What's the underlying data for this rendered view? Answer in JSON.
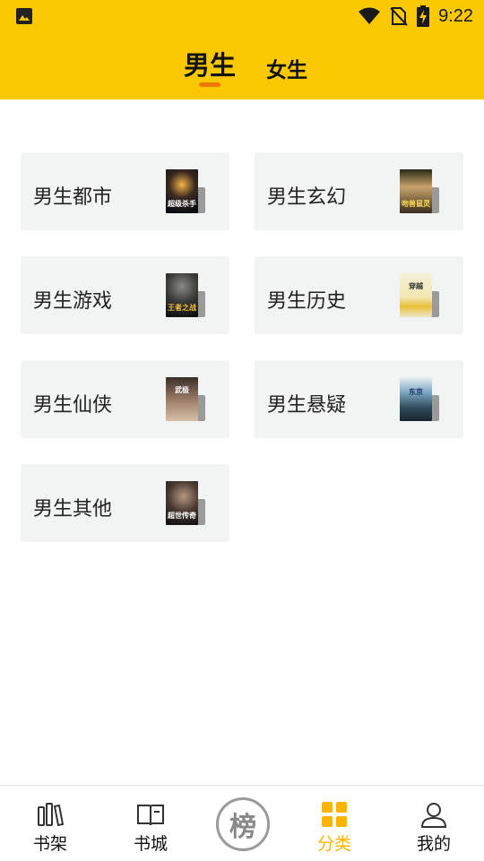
{
  "status_bar": {
    "time": "9:22",
    "icons": [
      "image-icon",
      "wifi-icon",
      "no-sim-icon",
      "battery-charging-icon"
    ]
  },
  "header": {
    "tabs": [
      {
        "label": "男生",
        "active": true
      },
      {
        "label": "女生",
        "active": false
      }
    ],
    "accent_color": "#FAC800",
    "indicator_color": "#F07800"
  },
  "categories": [
    {
      "label": "男生都市",
      "cover_text": "超级杀手"
    },
    {
      "label": "男生玄幻",
      "cover_text": "吻兽鼠灵"
    },
    {
      "label": "男生游戏",
      "cover_text": "王者之战"
    },
    {
      "label": "男生历史",
      "cover_text": "穿越"
    },
    {
      "label": "男生仙侠",
      "cover_text": "武极"
    },
    {
      "label": "男生悬疑",
      "cover_text": "东京"
    },
    {
      "label": "男生其他",
      "cover_text": "超世传奇"
    }
  ],
  "bottom_nav": {
    "items": [
      {
        "label": "书架",
        "icon": "bookshelf-icon",
        "active": false
      },
      {
        "label": "书城",
        "icon": "book-open-icon",
        "active": false
      },
      {
        "label": "榜",
        "icon": "ranking-icon",
        "active": false
      },
      {
        "label": "分类",
        "icon": "category-grid-icon",
        "active": true
      },
      {
        "label": "我的",
        "icon": "user-icon",
        "active": false
      }
    ],
    "active_color": "#FAB400"
  }
}
